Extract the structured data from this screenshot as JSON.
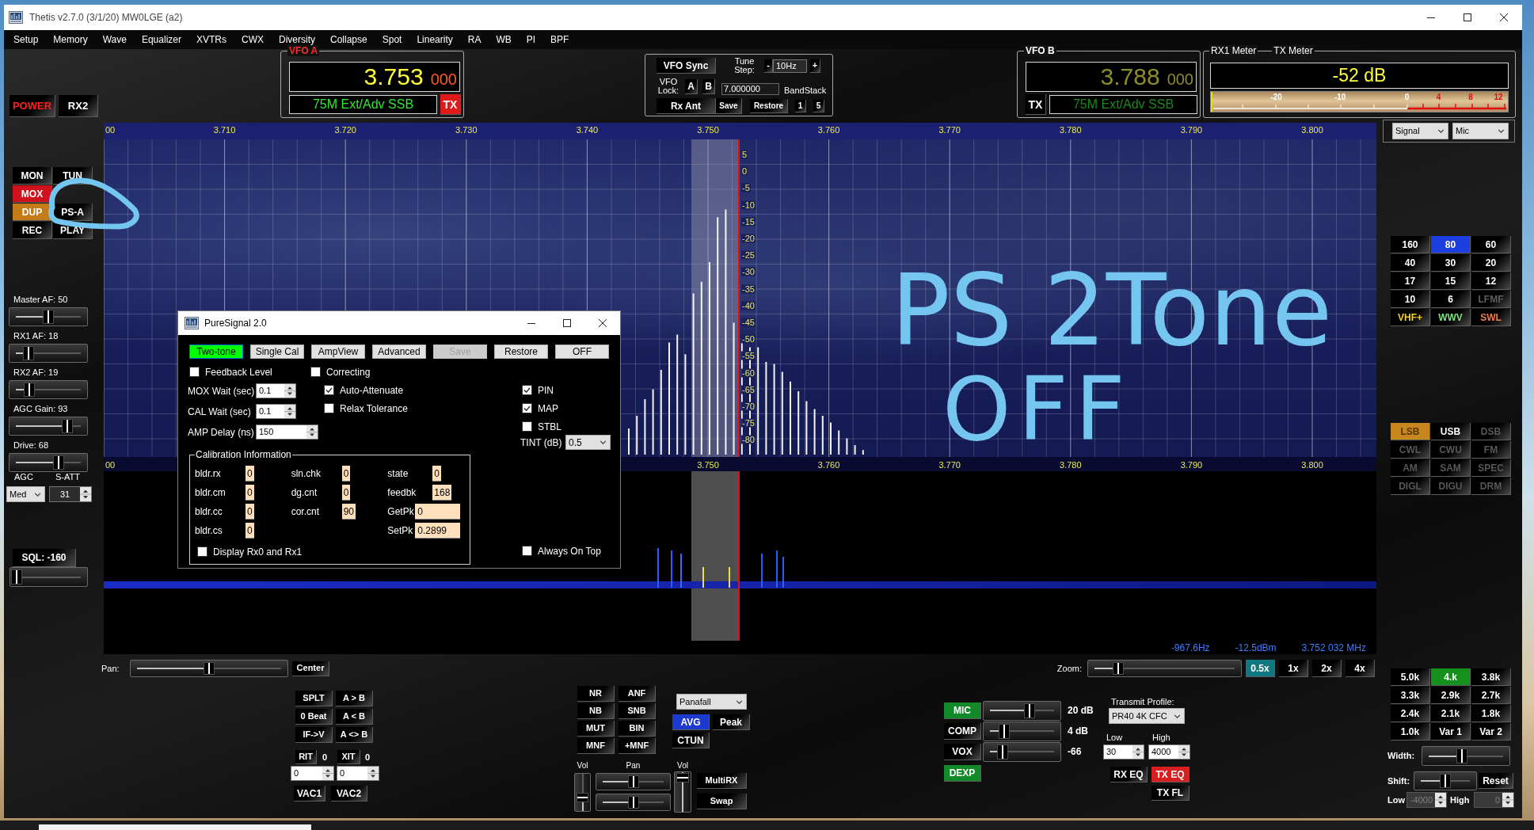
{
  "window": {
    "title": "Thetis v2.7.0 (3/1/20) MW0LGE (a2)"
  },
  "menu": [
    "Setup",
    "Memory",
    "Wave",
    "Equalizer",
    "XVTRs",
    "CWX",
    "Diversity",
    "Collapse",
    "Spot",
    "Linearity",
    "RA",
    "WB",
    "PI",
    "BPF"
  ],
  "power": [
    {
      "label": "POWER",
      "on": true
    },
    {
      "label": "RX2",
      "on": false
    }
  ],
  "vfo_a": {
    "legend": "VFO A",
    "mhz": "3.753",
    "hz": "000",
    "band": "75M Ext/Adv SSB",
    "tx_label": "TX",
    "tx": true,
    "active": true
  },
  "vfo_sync": {
    "sync": "VFO Sync",
    "step_label": "Tune Step:",
    "step_minus": "-",
    "step": "10Hz",
    "step_plus": "+",
    "lock_label": "VFO Lock:",
    "lock": [
      "A",
      "B"
    ],
    "stack_value": "7.000000",
    "bandstack": "BandStack",
    "rx_ant": "Rx Ant",
    "save": "Save",
    "restore": "Restore",
    "stack": [
      "1",
      "5"
    ]
  },
  "vfo_b": {
    "legend": "VFO B",
    "mhz": "3.788",
    "hz": "000",
    "band": "75M Ext/Adv SSB",
    "tx_label": "TX",
    "tx": false,
    "active": false
  },
  "meter": {
    "legends": [
      "RX1 Meter",
      "TX Meter"
    ],
    "reading": "-52 dB",
    "level": 0,
    "scale": [
      {
        "label": "-20",
        "over": false
      },
      {
        "label": "-10",
        "over": false
      },
      {
        "label": "0",
        "over": false
      },
      {
        "label": "4",
        "over": true
      },
      {
        "label": "8",
        "over": true
      },
      {
        "label": "12",
        "over": true
      }
    ],
    "selectors": [
      "Signal",
      "Mic"
    ]
  },
  "left_panel": {
    "buttons": [
      [
        {
          "label": "MON",
          "on": false
        },
        {
          "label": "TUN",
          "on": false
        }
      ],
      [
        {
          "label": "MOX",
          "on": true,
          "color": "#d0121c"
        }
      ],
      [
        {
          "label": "DUP",
          "on": true,
          "color": "#c47c18"
        },
        {
          "label": "PS-A",
          "on": false
        }
      ],
      [
        {
          "label": "REC",
          "on": false
        },
        {
          "label": "PLAY",
          "on": false
        }
      ]
    ],
    "sliders": [
      {
        "label": "Master AF: 50",
        "level": 0.5
      },
      {
        "label": "RX1 AF: 18",
        "level": 0.2
      },
      {
        "label": "RX2 AF: 19",
        "level": 0.21
      },
      {
        "label": "AGC Gain: 93",
        "level": 0.79
      },
      {
        "label": "Drive: 68",
        "level": 0.66
      }
    ],
    "agc": {
      "label": "AGC",
      "value": "Med"
    },
    "s_att": {
      "label": "S-ATT",
      "value": "31"
    },
    "squelch": {
      "label": "SQL: -160",
      "on": false,
      "level": 0
    }
  },
  "panadapter": {
    "top_scale": [
      "00",
      "3.710",
      "3.720",
      "3.730",
      "3.740",
      "3.750",
      "3.760",
      "3.770",
      "3.780",
      "3.790",
      "3.800"
    ],
    "db_scale": [
      "5",
      "0",
      "-5",
      "-10",
      "-15",
      "-20",
      "-25",
      "-30",
      "-35",
      "-40",
      "-45",
      "-50",
      "-55",
      "-60",
      "-65",
      "-70",
      "-75",
      "-80"
    ],
    "bottom_scale": [
      "00",
      "3.750",
      "3.760",
      "3.770",
      "3.780",
      "3.790",
      "3.800"
    ],
    "readout": [
      "-967.6Hz",
      "-12.5dBm",
      "3.752 032 MHz"
    ]
  },
  "puresignal": {
    "title": "PureSignal 2.0",
    "buttons": [
      {
        "label": "Two-tone",
        "on": true,
        "disabled": false
      },
      {
        "label": "Single Cal",
        "on": false,
        "disabled": false
      },
      {
        "label": "AmpView",
        "on": false,
        "disabled": false
      },
      {
        "label": "Advanced",
        "on": false,
        "disabled": false
      },
      {
        "label": "Save",
        "on": false,
        "disabled": true
      },
      {
        "label": "Restore",
        "on": false,
        "disabled": false
      },
      {
        "label": "OFF",
        "on": false,
        "disabled": false
      }
    ],
    "checks_top": [
      {
        "label": "Feedback Level",
        "checked": false
      },
      {
        "label": "Correcting",
        "checked": false
      }
    ],
    "spins": [
      {
        "label": "MOX Wait (sec)",
        "value": "0.1"
      },
      {
        "label": "CAL Wait (sec)",
        "value": "0.1"
      },
      {
        "label": "AMP Delay (ns)",
        "value": "150"
      }
    ],
    "checks_mid": [
      {
        "label": "Auto-Attenuate",
        "checked": true
      },
      {
        "label": "Relax Tolerance",
        "checked": false
      }
    ],
    "checks_right": [
      {
        "label": "PIN",
        "checked": true
      },
      {
        "label": "MAP",
        "checked": true
      },
      {
        "label": "STBL",
        "checked": false
      }
    ],
    "tint": {
      "label": "TINT (dB)",
      "value": "0.5"
    },
    "calibration": {
      "legend": "Calibration Information",
      "columns": [
        [
          {
            "label": "bldr.rx",
            "value": "0"
          },
          {
            "label": "bldr.cm",
            "value": "0"
          },
          {
            "label": "bldr.cc",
            "value": "0"
          },
          {
            "label": "bldr.cs",
            "value": "0"
          }
        ],
        [
          {
            "label": "sln.chk",
            "value": "0"
          },
          {
            "label": "dg.cnt",
            "value": "0"
          },
          {
            "label": "cor.cnt",
            "value": "90"
          }
        ],
        [
          {
            "label": "state",
            "value": "0",
            "kind": "narrow"
          },
          {
            "label": "feedbk",
            "value": "168",
            "kind": "narrow"
          },
          {
            "label": "GetPk",
            "value": "0",
            "kind": "wide"
          },
          {
            "label": "SetPk",
            "value": "0.2899",
            "kind": "wide"
          }
        ]
      ],
      "display_rx": {
        "label": "Display Rx0 and Rx1",
        "checked": false
      }
    },
    "always_on_top": {
      "label": "Always On Top",
      "checked": false
    }
  },
  "right_panel": {
    "bands": [
      {
        "label": "160",
        "selected": false,
        "disabled": false
      },
      {
        "label": "80",
        "selected": true,
        "disabled": false
      },
      {
        "label": "60",
        "selected": false,
        "disabled": false
      },
      {
        "label": "40",
        "selected": false,
        "disabled": false
      },
      {
        "label": "30",
        "selected": false,
        "disabled": false
      },
      {
        "label": "20",
        "selected": false,
        "disabled": false
      },
      {
        "label": "17",
        "selected": false,
        "disabled": false
      },
      {
        "label": "15",
        "selected": false,
        "disabled": false
      },
      {
        "label": "12",
        "selected": false,
        "disabled": false
      },
      {
        "label": "10",
        "selected": false,
        "disabled": false
      },
      {
        "label": "6",
        "selected": false,
        "disabled": false
      },
      {
        "label": "LFMF",
        "selected": false,
        "disabled": true
      },
      {
        "label": "VHF+",
        "selected": false,
        "disabled": false,
        "color": "#f2d21e"
      },
      {
        "label": "WWV",
        "selected": false,
        "disabled": false,
        "color": "#7ee07e"
      },
      {
        "label": "SWL",
        "selected": false,
        "disabled": false,
        "color": "#f07a4a"
      }
    ],
    "modes": [
      {
        "label": "LSB",
        "selected": true,
        "disabled": false
      },
      {
        "label": "USB",
        "selected": false,
        "disabled": false
      },
      {
        "label": "DSB",
        "selected": false,
        "disabled": true
      },
      {
        "label": "CWL",
        "selected": false,
        "disabled": true
      },
      {
        "label": "CWU",
        "selected": false,
        "disabled": true
      },
      {
        "label": "FM",
        "selected": false,
        "disabled": true
      },
      {
        "label": "AM",
        "selected": false,
        "disabled": true
      },
      {
        "label": "SAM",
        "selected": false,
        "disabled": true
      },
      {
        "label": "SPEC",
        "selected": false,
        "disabled": true
      },
      {
        "label": "DIGL",
        "selected": false,
        "disabled": true
      },
      {
        "label": "DIGU",
        "selected": false,
        "disabled": true
      },
      {
        "label": "DRM",
        "selected": false,
        "disabled": true
      }
    ],
    "filters": [
      {
        "label": "5.0k",
        "selected": false
      },
      {
        "label": "4.k",
        "selected": true
      },
      {
        "label": "3.8k",
        "selected": false
      },
      {
        "label": "3.3k",
        "selected": false
      },
      {
        "label": "2.9k",
        "selected": false
      },
      {
        "label": "2.7k",
        "selected": false
      },
      {
        "label": "2.4k",
        "selected": false
      },
      {
        "label": "2.1k",
        "selected": false
      },
      {
        "label": "1.8k",
        "selected": false
      },
      {
        "label": "1.0k",
        "selected": false
      },
      {
        "label": "Var 1",
        "selected": false
      },
      {
        "label": "Var 2",
        "selected": false
      }
    ],
    "width": {
      "label": "Width:",
      "level": 0.45
    },
    "shift": {
      "label": "Shift:",
      "level": 0.5,
      "reset": "Reset"
    },
    "low": {
      "label": "Low",
      "value": "-4000",
      "disabled": true
    },
    "high": {
      "label": "High",
      "value": "0",
      "disabled": true
    }
  },
  "bottom": {
    "pan": {
      "label": "Pan:",
      "level": 0.5,
      "button": "Center"
    },
    "zoom": {
      "label": "Zoom:",
      "level": 0.17,
      "buttons": [
        {
          "label": "0.5x",
          "selected": true
        },
        {
          "label": "1x",
          "selected": false
        },
        {
          "label": "2x",
          "selected": false
        },
        {
          "label": "4x",
          "selected": false
        }
      ]
    },
    "vfo_buttons": [
      "SPLT",
      "A > B",
      "0 Beat",
      "A < B",
      "IF->V",
      "A <> B"
    ],
    "rit": {
      "label": "RIT",
      "value": "0",
      "on": false
    },
    "xit": {
      "label": "XIT",
      "value": "0",
      "on": false
    },
    "offsets": [
      "0",
      "0"
    ],
    "vac": [
      "VAC1",
      "VAC2"
    ],
    "dsp": [
      "NR",
      "ANF",
      "NB",
      "SNB",
      "MUT",
      "BIN",
      "MNF",
      "+MNF"
    ],
    "display": {
      "mode": "Panafall",
      "buttons": [
        {
          "label": "AVG",
          "selected": true
        },
        {
          "label": "Peak",
          "selected": false
        },
        {
          "label": "CTUN",
          "selected": false
        }
      ]
    },
    "audio": {
      "labels": [
        "Vol",
        "Pan",
        "Vol"
      ],
      "volumes": [
        {
          "level": 0.3
        },
        {
          "level": 1
        }
      ],
      "pans": [
        {
          "level": 0.5
        },
        {
          "level": 0.5
        }
      ],
      "buttons": [
        "MultiRX",
        "Swap"
      ]
    },
    "tx": {
      "rows": [
        {
          "label": "MIC",
          "on": true,
          "level": 0.62,
          "reading": "20 dB"
        },
        {
          "label": "COMP",
          "on": false,
          "level": 0.22,
          "reading": "4 dB"
        },
        {
          "label": "VOX",
          "on": false,
          "level": 0.2,
          "reading": "-66"
        }
      ],
      "dexp": {
        "label": "DEXP",
        "on": true
      }
    },
    "profile": {
      "label": "Transmit Profile:",
      "value": "PR40 4K CFC",
      "low_label": "Low",
      "high_label": "High",
      "low": "30",
      "high": "4000",
      "eq": [
        {
          "label": "RX EQ",
          "on": false
        },
        {
          "label": "TX EQ",
          "on": true
        },
        {
          "label": "TX FL",
          "on": false
        }
      ]
    }
  },
  "annotation": {
    "lines": [
      "PS 2Tone",
      "OFF"
    ]
  }
}
